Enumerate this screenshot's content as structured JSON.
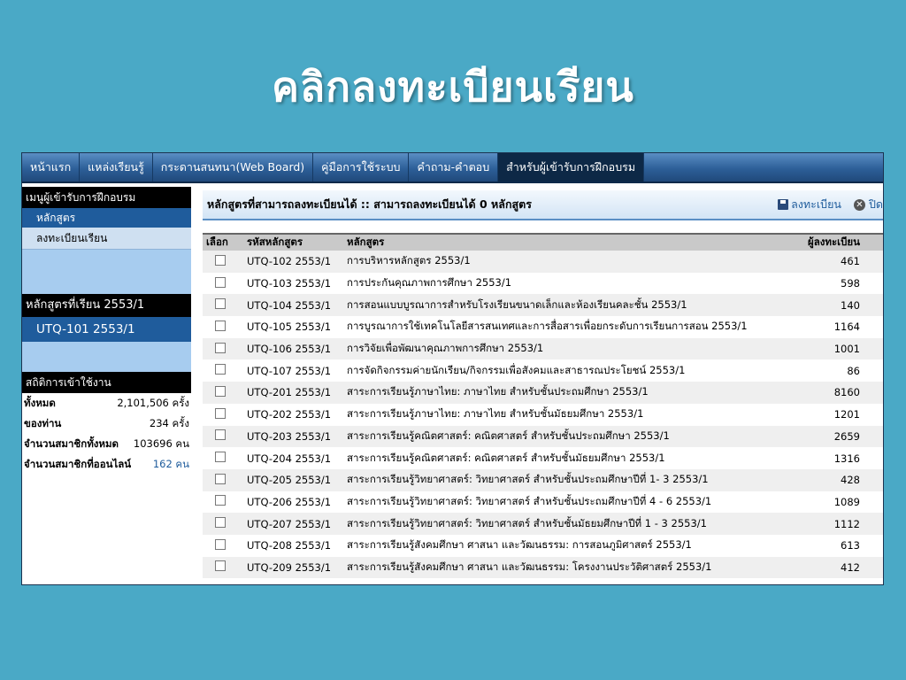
{
  "slide": {
    "title": "คลิกลงทะเบียนเรียน"
  },
  "topnav": [
    {
      "label": "หน้าแรก"
    },
    {
      "label": "แหล่งเรียนรู้"
    },
    {
      "label": "กระดานสนทนา(Web Board)"
    },
    {
      "label": "คู่มือการใช้ระบบ"
    },
    {
      "label": "คำถาม-คำตอบ"
    },
    {
      "label": "สำหรับผู้เข้ารับการฝึกอบรม"
    }
  ],
  "sidebar": {
    "menu_title": "เมนูผู้เข้ารับการฝึกอบรม",
    "items": [
      {
        "label": "หลักสูตร"
      },
      {
        "label": "ลงทะเบียนเรียน"
      }
    ],
    "courses_title": "หลักสูตรที่เรียน 2553/1",
    "current_course": "UTQ-101 2553/1",
    "stats_title": "สถิติการเข้าใช้งาน",
    "stats": [
      {
        "label": "ทั้งหมด",
        "value": "2,101,506 ครั้ง"
      },
      {
        "label": "ของท่าน",
        "value": "234 ครั้ง"
      },
      {
        "label": "จำนวนสมาชิกทั้งหมด",
        "value": "103696 คน"
      },
      {
        "label": "จำนวนสมาชิกที่ออนไลน์",
        "value": "162 คน"
      }
    ]
  },
  "main": {
    "header": "หลักสูตรที่สามารถลงทะเบียนได้ :: สามารถลงทะเบียนได้ 0 หลักสูตร",
    "save_label": "ลงทะเบียน",
    "close_label": "ปิด",
    "columns": [
      "เลือก",
      "รหัสหลักสูตร",
      "หลักสูตร",
      "ผู้ลงทะเบียน"
    ],
    "rows": [
      {
        "code": "UTQ-102 2553/1",
        "name": "การบริหารหลักสูตร 2553/1",
        "count": "461"
      },
      {
        "code": "UTQ-103 2553/1",
        "name": "การประกันคุณภาพการศึกษา 2553/1",
        "count": "598"
      },
      {
        "code": "UTQ-104 2553/1",
        "name": "การสอนแบบบูรณาการสำหรับโรงเรียนขนาดเล็กและห้องเรียนคละชั้น 2553/1",
        "count": "140"
      },
      {
        "code": "UTQ-105 2553/1",
        "name": "การบูรณาการใช้เทคโนโลยีสารสนเทศและการสื่อสารเพื่อยกระดับการเรียนการสอน 2553/1",
        "count": "1164"
      },
      {
        "code": "UTQ-106 2553/1",
        "name": "การวิจัยเพื่อพัฒนาคุณภาพการศึกษา 2553/1",
        "count": "1001"
      },
      {
        "code": "UTQ-107 2553/1",
        "name": "การจัดกิจกรรมค่ายนักเรียน/กิจกรรมเพื่อสังคมและสาธารณประโยชน์ 2553/1",
        "count": "86"
      },
      {
        "code": "UTQ-201 2553/1",
        "name": "สาระการเรียนรู้ภาษาไทย: ภาษาไทย สำหรับชั้นประถมศึกษา 2553/1",
        "count": "8160"
      },
      {
        "code": "UTQ-202 2553/1",
        "name": "สาระการเรียนรู้ภาษาไทย: ภาษาไทย สำหรับชั้นมัธยมศึกษา 2553/1",
        "count": "1201"
      },
      {
        "code": "UTQ-203 2553/1",
        "name": "สาระการเรียนรู้คณิตศาสตร์: คณิตศาสตร์ สำหรับชั้นประถมศึกษา 2553/1",
        "count": "2659"
      },
      {
        "code": "UTQ-204 2553/1",
        "name": "สาระการเรียนรู้คณิตศาสตร์: คณิตศาสตร์ สำหรับชั้นมัธยมศึกษา 2553/1",
        "count": "1316"
      },
      {
        "code": "UTQ-205 2553/1",
        "name": "สาระการเรียนรู้วิทยาศาสตร์: วิทยาศาสตร์ สำหรับชั้นประถมศึกษาปีที่ 1- 3 2553/1",
        "count": "428"
      },
      {
        "code": "UTQ-206 2553/1",
        "name": "สาระการเรียนรู้วิทยาศาสตร์: วิทยาศาสตร์ สำหรับชั้นประถมศึกษาปีที่ 4 - 6 2553/1",
        "count": "1089"
      },
      {
        "code": "UTQ-207 2553/1",
        "name": "สาระการเรียนรู้วิทยาศาสตร์: วิทยาศาสตร์ สำหรับชั้นมัธยมศึกษาปีที่ 1 - 3 2553/1",
        "count": "1112"
      },
      {
        "code": "UTQ-208 2553/1",
        "name": "สาระการเรียนรู้สังคมศึกษา ศาสนา และวัฒนธรรม: การสอนภูมิศาสตร์ 2553/1",
        "count": "613"
      },
      {
        "code": "UTQ-209 2553/1",
        "name": "สาระการเรียนรู้สังคมศึกษา ศาสนา และวัฒนธรรม: โครงงานประวัติศาสตร์ 2553/1",
        "count": "412"
      }
    ]
  }
}
